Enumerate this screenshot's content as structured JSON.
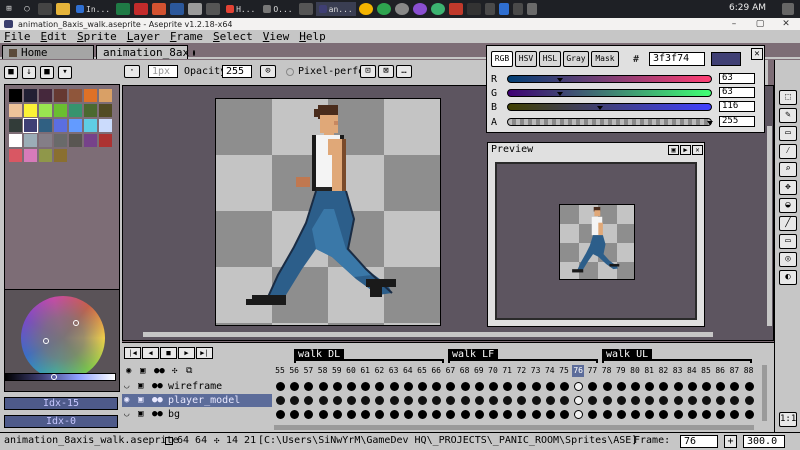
{
  "taskbar": {
    "clock": "6:29 AM",
    "tasks": [
      {
        "label": "In...",
        "color": "#2f6fd1"
      },
      {
        "label": "H...",
        "color": "#e34234"
      },
      {
        "label": "O...",
        "color": "#3a3a3a"
      },
      {
        "label": "an...",
        "color": "#3f3f74"
      }
    ]
  },
  "window": {
    "title": "animation_8axis_walk.aseprite - Aseprite v1.2.18-x64",
    "minimize": "–",
    "maximize": "▢",
    "close": "✕"
  },
  "menu": [
    {
      "label": "File",
      "key": "F",
      "rest": "ile"
    },
    {
      "label": "Edit",
      "key": "E",
      "rest": "dit"
    },
    {
      "label": "Sprite",
      "key": "S",
      "rest": "prite"
    },
    {
      "label": "Layer",
      "key": "L",
      "rest": "ayer"
    },
    {
      "label": "Frame",
      "key": "F",
      "rest": "rame"
    },
    {
      "label": "Select",
      "key": "S",
      "rest": "elect"
    },
    {
      "label": "View",
      "key": "V",
      "rest": "iew"
    },
    {
      "label": "Help",
      "key": "H",
      "rest": "elp"
    }
  ],
  "tabs": {
    "home": "Home",
    "active": "animation_8ax"
  },
  "context_bar": {
    "size_value": "1px",
    "opacity_label": "Opacity:",
    "opacity_value": "255",
    "pixel_perfect_label": "Pixel-perfect"
  },
  "palette": {
    "index_label_1": "Idx-15",
    "index_label_2": "Idx-0",
    "swatches": [
      "#000000",
      "#222034",
      "#45283c",
      "#663931",
      "#8f563b",
      "#df7126",
      "#d9a066",
      "#eec39a",
      "#fbf236",
      "#99e550",
      "#6abe30",
      "#37946e",
      "#4b692f",
      "#524b24",
      "#323c39",
      "#3f3f74",
      "#306082",
      "#5b6ee1",
      "#639bff",
      "#5fcde4",
      "#cbdbfc",
      "#ffffff",
      "#9badb7",
      "#847e87",
      "#696a6a",
      "#595652",
      "#76428a",
      "#ac3232",
      "#d95763",
      "#d77bba",
      "#8f974a",
      "#8a6f30"
    ]
  },
  "color_picker": {
    "tabs": [
      "RGB",
      "HSV",
      "HSL",
      "Gray",
      "Mask"
    ],
    "hash": "#",
    "hex": "3f3f74",
    "swatch_color": "#3f3f74",
    "channels": [
      {
        "label": "R",
        "value": "63",
        "pos": 0.25
      },
      {
        "label": "G",
        "value": "63",
        "pos": 0.25
      },
      {
        "label": "B",
        "value": "116",
        "pos": 0.45
      },
      {
        "label": "A",
        "value": "255",
        "pos": 1.0
      }
    ]
  },
  "preview": {
    "title": "Preview"
  },
  "timeline": {
    "tags": [
      "walk_DL",
      "walk_LF",
      "walk_UL"
    ],
    "frames": [
      "55",
      "56",
      "57",
      "58",
      "59",
      "60",
      "61",
      "62",
      "63",
      "64",
      "65",
      "66",
      "67",
      "68",
      "69",
      "70",
      "71",
      "72",
      "73",
      "74",
      "75",
      "76",
      "77",
      "78",
      "79",
      "80",
      "81",
      "82",
      "83",
      "84",
      "85",
      "86",
      "87",
      "88"
    ],
    "selected_frame": "76",
    "layers": [
      {
        "name": "wireframe",
        "selected": false
      },
      {
        "name": "player_model",
        "selected": true
      },
      {
        "name": "bg",
        "selected": false
      }
    ]
  },
  "status": {
    "filename": "animation_8axis_walk.aseprite",
    "size": "64 64",
    "cursor": "14 21",
    "path": "[C:\\Users\\SiNwYrM\\GameDev HQ\\_PROJECTS\\_PANIC_ROOM\\Sprites\\ASE]",
    "frame_label": "Frame:",
    "frame_value": "76",
    "zoom": "300.0"
  },
  "colors": {
    "workspace": "#7d6d76",
    "panel": "#c6c6c6",
    "selection": "#5c6c9a",
    "accent_index": "#3f3f74"
  }
}
